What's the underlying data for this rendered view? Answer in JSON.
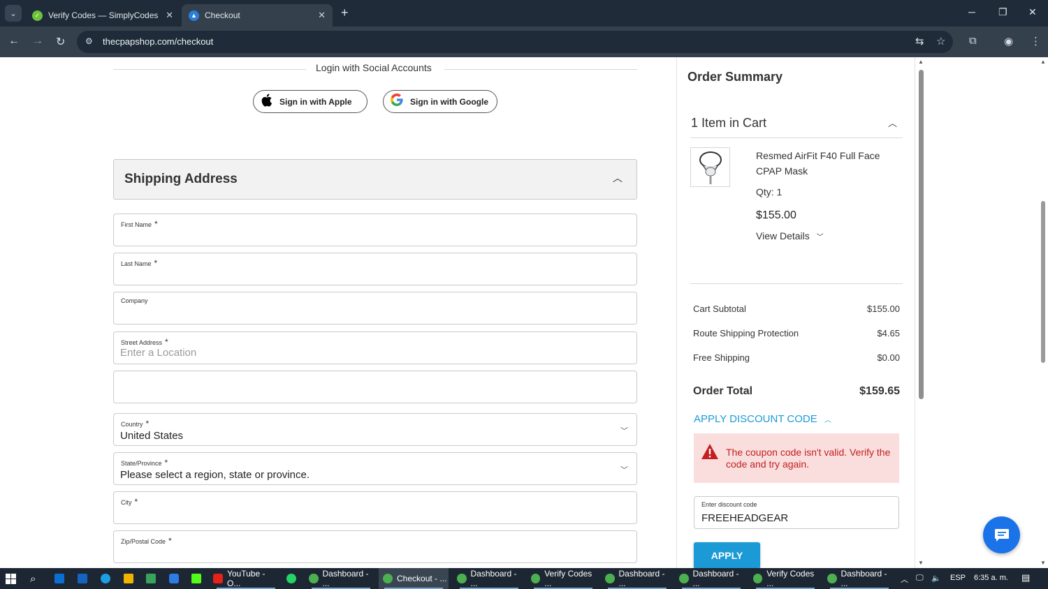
{
  "browser": {
    "tabs": [
      {
        "title": "Verify Codes — SimplyCodes",
        "active": false
      },
      {
        "title": "Checkout",
        "active": true
      }
    ],
    "url": "thecpapshop.com/checkout"
  },
  "social": {
    "title": "Login with Social Accounts",
    "apple_label": "Sign in with Apple",
    "google_label": "Sign in with Google"
  },
  "shipping": {
    "title": "Shipping Address",
    "fields": {
      "first_name": {
        "label": "First Name",
        "required": "*"
      },
      "last_name": {
        "label": "Last Name",
        "required": "*"
      },
      "company": {
        "label": "Company"
      },
      "street": {
        "label": "Street Address",
        "required": "*",
        "placeholder": "Enter a Location"
      },
      "country": {
        "label": "Country",
        "required": "*",
        "value": "United States"
      },
      "state": {
        "label": "State/Province",
        "required": "*",
        "value": "Please select a region, state or province."
      },
      "city": {
        "label": "City",
        "required": "*"
      },
      "zip": {
        "label": "Zip/Postal Code",
        "required": "*"
      }
    }
  },
  "summary": {
    "title": "Order Summary",
    "cart_count": "1 Item in Cart",
    "item": {
      "name": "Resmed AirFit F40 Full Face CPAP Mask",
      "qty": "Qty:  1",
      "price": "$155.00",
      "details": "View Details"
    },
    "totals": [
      {
        "label": "Cart Subtotal",
        "amount": "$155.00"
      },
      {
        "label": "Route Shipping Protection",
        "amount": "$4.65"
      },
      {
        "label": "Free Shipping",
        "amount": "$0.00"
      }
    ],
    "order_total": {
      "label": "Order Total",
      "amount": "$159.65"
    },
    "discount_toggle": "APPLY DISCOUNT CODE",
    "error": "The coupon code isn't valid. Verify the code and try again.",
    "discount_label": "Enter discount code",
    "discount_value": "FREEHEADGEAR",
    "apply": "APPLY"
  },
  "taskbar": {
    "items": [
      {
        "label": "YouTube - O...",
        "color": "#e62117"
      },
      {
        "label": "Dashboard - ...",
        "color": "#4caf50"
      },
      {
        "label": "Checkout - ...",
        "color": "#4caf50"
      },
      {
        "label": "Dashboard - ...",
        "color": "#4caf50"
      },
      {
        "label": "Verify Codes ...",
        "color": "#4caf50"
      },
      {
        "label": "Dashboard - ...",
        "color": "#4caf50"
      },
      {
        "label": "Dashboard - ...",
        "color": "#4caf50"
      },
      {
        "label": "Verify Codes ...",
        "color": "#4caf50"
      },
      {
        "label": "Dashboard - ...",
        "color": "#4caf50"
      }
    ],
    "lang": "ESP",
    "time": "6:35 a. m."
  },
  "colors": {
    "accent": "#1c9ad6",
    "error_bg": "#fadede",
    "error_text": "#c31f1f",
    "chat": "#1a73e8"
  }
}
